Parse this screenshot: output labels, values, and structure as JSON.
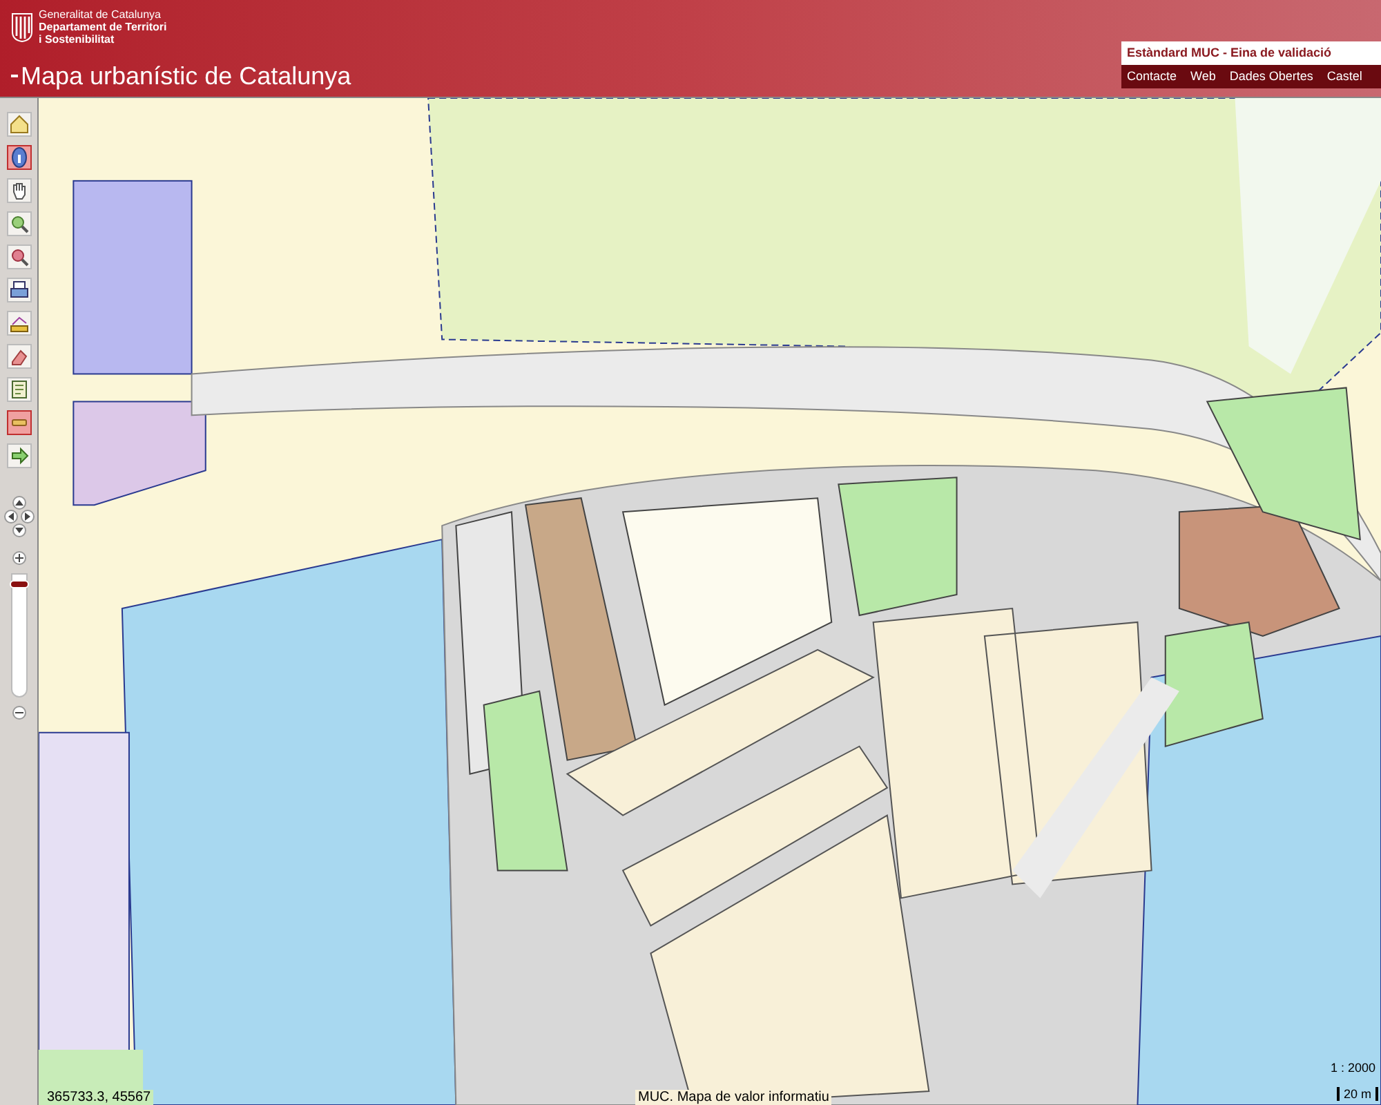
{
  "header": {
    "org_lines": [
      "Generalitat de Catalunya",
      "Departament de Territori",
      "i Sostenibilitat"
    ],
    "title": "Mapa urbanístic de Catalunya",
    "tool_title": "Estàndard MUC - Eina de validació",
    "nav": [
      "Contacte",
      "Web",
      "Dades Obertes",
      "Castel"
    ]
  },
  "toolbar": [
    {
      "kind": "home",
      "selected": false
    },
    {
      "kind": "info",
      "selected": true
    },
    {
      "kind": "pan",
      "selected": false
    },
    {
      "kind": "zoom-in",
      "selected": false
    },
    {
      "kind": "zoom-out",
      "selected": false
    },
    {
      "kind": "print",
      "selected": false
    },
    {
      "kind": "measure",
      "selected": false
    },
    {
      "kind": "erase",
      "selected": false
    },
    {
      "kind": "legend",
      "selected": false
    },
    {
      "kind": "minus",
      "selected": true
    },
    {
      "kind": "next",
      "selected": false
    }
  ],
  "zoom": {
    "level": 0.95
  },
  "map": {
    "coordinates": "365733.3, 45567",
    "notice": "MUC. Mapa de valor informatiu",
    "scale": "1 : 2000",
    "scale_bar": "20 m"
  }
}
